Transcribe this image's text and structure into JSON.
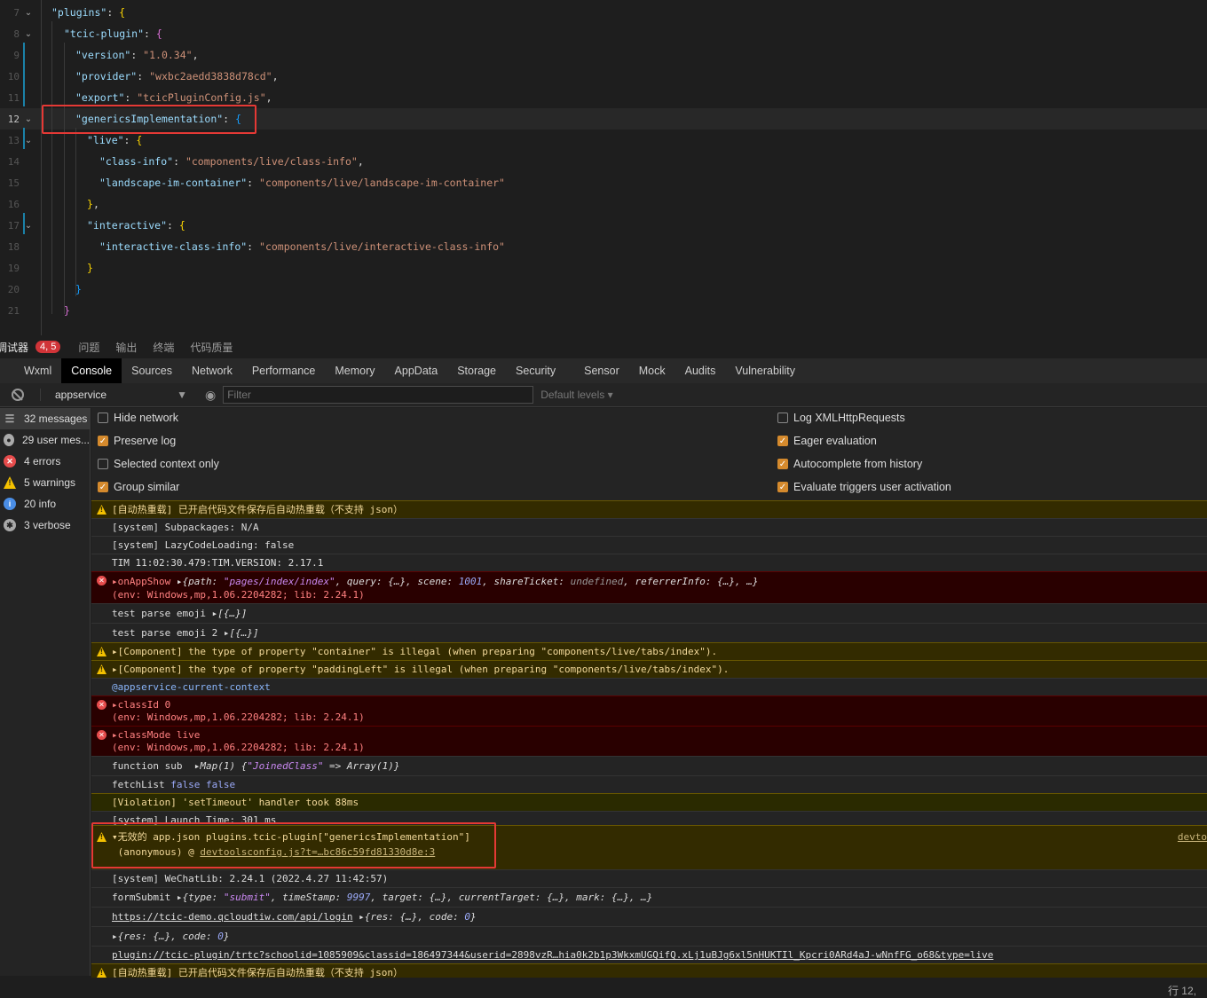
{
  "editor": {
    "lines": [
      {
        "n": "7",
        "code": [
          {
            "t": "\"plugins\"",
            "c": "k"
          },
          {
            "t": ": ",
            "c": "p"
          },
          {
            "t": "{",
            "c": "b1"
          }
        ]
      },
      {
        "n": "8",
        "code": [
          {
            "t": "\"tcic-plugin\"",
            "c": "k"
          },
          {
            "t": ": ",
            "c": "p"
          },
          {
            "t": "{",
            "c": "b2"
          }
        ]
      },
      {
        "n": "9",
        "code": [
          {
            "t": "\"version\"",
            "c": "k"
          },
          {
            "t": ": ",
            "c": "p"
          },
          {
            "t": "\"1.0.34\"",
            "c": "s"
          },
          {
            "t": ",",
            "c": "p"
          }
        ]
      },
      {
        "n": "10",
        "code": [
          {
            "t": "\"provider\"",
            "c": "k"
          },
          {
            "t": ": ",
            "c": "p"
          },
          {
            "t": "\"wxbc2aedd3838d78cd\"",
            "c": "s"
          },
          {
            "t": ",",
            "c": "p"
          }
        ]
      },
      {
        "n": "11",
        "code": [
          {
            "t": "\"export\"",
            "c": "k"
          },
          {
            "t": ": ",
            "c": "p"
          },
          {
            "t": "\"tcicPluginConfig.js\"",
            "c": "s"
          },
          {
            "t": ",",
            "c": "p"
          }
        ]
      },
      {
        "n": "12",
        "code": [
          {
            "t": "\"genericsImplementation\"",
            "c": "k"
          },
          {
            "t": ": ",
            "c": "p"
          },
          {
            "t": "{",
            "c": "b3"
          }
        ]
      },
      {
        "n": "13",
        "code": [
          {
            "t": "\"live\"",
            "c": "k"
          },
          {
            "t": ": ",
            "c": "p"
          },
          {
            "t": "{",
            "c": "b1"
          }
        ]
      },
      {
        "n": "14",
        "code": [
          {
            "t": "\"class-info\"",
            "c": "k"
          },
          {
            "t": ": ",
            "c": "p"
          },
          {
            "t": "\"components/live/class-info\"",
            "c": "s"
          },
          {
            "t": ",",
            "c": "p"
          }
        ]
      },
      {
        "n": "15",
        "code": [
          {
            "t": "\"landscape-im-container\"",
            "c": "k"
          },
          {
            "t": ": ",
            "c": "p"
          },
          {
            "t": "\"components/live/landscape-im-container\"",
            "c": "s"
          }
        ]
      },
      {
        "n": "16",
        "code": [
          {
            "t": "}",
            "c": "b1"
          },
          {
            "t": ",",
            "c": "p"
          }
        ]
      },
      {
        "n": "17",
        "code": [
          {
            "t": "\"interactive\"",
            "c": "k"
          },
          {
            "t": ": ",
            "c": "p"
          },
          {
            "t": "{",
            "c": "b1"
          }
        ]
      },
      {
        "n": "18",
        "code": [
          {
            "t": "\"interactive-class-info\"",
            "c": "k"
          },
          {
            "t": ": ",
            "c": "p"
          },
          {
            "t": "\"components/live/interactive-class-info\"",
            "c": "s"
          }
        ]
      },
      {
        "n": "19",
        "code": [
          {
            "t": "}",
            "c": "b1"
          }
        ]
      },
      {
        "n": "20",
        "code": [
          {
            "t": "}",
            "c": "b3"
          }
        ]
      },
      {
        "n": "21",
        "code": [
          {
            "t": "}",
            "c": "b2"
          }
        ]
      }
    ]
  },
  "panel_bar": {
    "debugger": "调试器",
    "badge": "4, 5",
    "problems": "问题",
    "output": "输出",
    "terminal": "终端",
    "quality": "代码质量"
  },
  "devtools_tabs": [
    "Wxml",
    "Console",
    "Sources",
    "Network",
    "Performance",
    "Memory",
    "AppData",
    "Storage",
    "Security",
    "Sensor",
    "Mock",
    "Audits",
    "Vulnerability"
  ],
  "filter_bar": {
    "context": "appservice",
    "filter_placeholder": "Filter",
    "levels": "Default levels"
  },
  "sidebar": [
    {
      "label": "32 messages",
      "icon": "list-icon"
    },
    {
      "label": "29 user mes...",
      "icon": "user-icon"
    },
    {
      "label": "4 errors",
      "icon": "error-icon"
    },
    {
      "label": "5 warnings",
      "icon": "warning-icon"
    },
    {
      "label": "20 info",
      "icon": "info-icon"
    },
    {
      "label": "3 verbose",
      "icon": "bug-icon"
    }
  ],
  "settings": {
    "left": [
      {
        "label": "Hide network",
        "checked": false
      },
      {
        "label": "Preserve log",
        "checked": true
      },
      {
        "label": "Selected context only",
        "checked": false
      },
      {
        "label": "Group similar",
        "checked": true
      }
    ],
    "right": [
      {
        "label": "Log XMLHttpRequests",
        "checked": false
      },
      {
        "label": "Eager evaluation",
        "checked": true
      },
      {
        "label": "Autocomplete from history",
        "checked": true
      },
      {
        "label": "Evaluate triggers user activation",
        "checked": true
      }
    ]
  },
  "console": {
    "m1": "[自动热重载] 已开启代码文件保存后自动热重载（不支持 json）",
    "m2": "[system] Subpackages: N/A",
    "m3": "[system] LazyCodeLoading: false",
    "m4": "TIM 11:02:30.479:TIM.VERSION: 2.17.1",
    "m5a": "onAppShow",
    "m5b": "{path: ",
    "m5c": "\"pages/index/index\"",
    "m5d": ", query: {…}, scene: ",
    "m5e": "1001",
    "m5f": ", shareTicket: ",
    "m5g": "undefined",
    "m5h": ", referrerInfo: {…}, …}",
    "env": "(env: Windows,mp,1.06.2204282; lib: 2.24.1)",
    "m6a": "test parse emoji",
    "m6b": "[{…}]",
    "m7a": "test parse emoji 2",
    "m7b": "[{…}]",
    "m8": "[Component] the type of property \"container\" is illegal (when preparing \"components/live/tabs/index\").",
    "m9": "[Component] the type of property \"paddingLeft\" is illegal (when preparing \"components/live/tabs/index\").",
    "m10": "@appservice-current-context",
    "m11": "classId 0",
    "m12": "classMode live",
    "m13a": "function sub",
    "m13b": "Map(1) {",
    "m13c": "\"JoinedClass\"",
    "m13d": " => Array(1)}",
    "m14a": "fetchList",
    "m14b": "false false",
    "m15": "[Violation] 'setTimeout' handler took 88ms",
    "m16": "[system] Launch Time: 301 ms",
    "m17a": "无效的 app.json plugins.tcic-plugin[\"genericsImplementation\"]",
    "m17b": "(anonymous) @ ",
    "m17c": "devtoolsconfig.js?t=…bc86c59fd81330d8e:3",
    "m17d": "devto",
    "m18": "[system] WeChatLib: 2.24.1 (2022.4.27 11:42:57)",
    "m19a": "formSubmit",
    "m19b": "{type: ",
    "m19c": "\"submit\"",
    "m19d": ", timeStamp: ",
    "m19e": "9997",
    "m19f": ", target: {…}, currentTarget: {…}, mark: {…}, …}",
    "m20a": "https://tcic-demo.qcloudtiw.com/api/login",
    "m20b": "{res: {…}, code: ",
    "m20c": "0",
    "m20d": "}",
    "m21a": "{res: {…}, code: ",
    "m21b": "0",
    "m21c": "}",
    "m22": "plugin://tcic-plugin/trtc?schoolid=1085909&classid=186497344&userid=2898vzR…hia0k2b1p3WkxmUGQifQ.xLj1uBJg6xl5nHUKTIl_Kpcri0ARd4aJ-wNnfFG_o68&type=live",
    "m23": "[自动热重载] 已开启代码文件保存后自动热重载（不支持 json）"
  },
  "status": {
    "position": "行 12,"
  }
}
